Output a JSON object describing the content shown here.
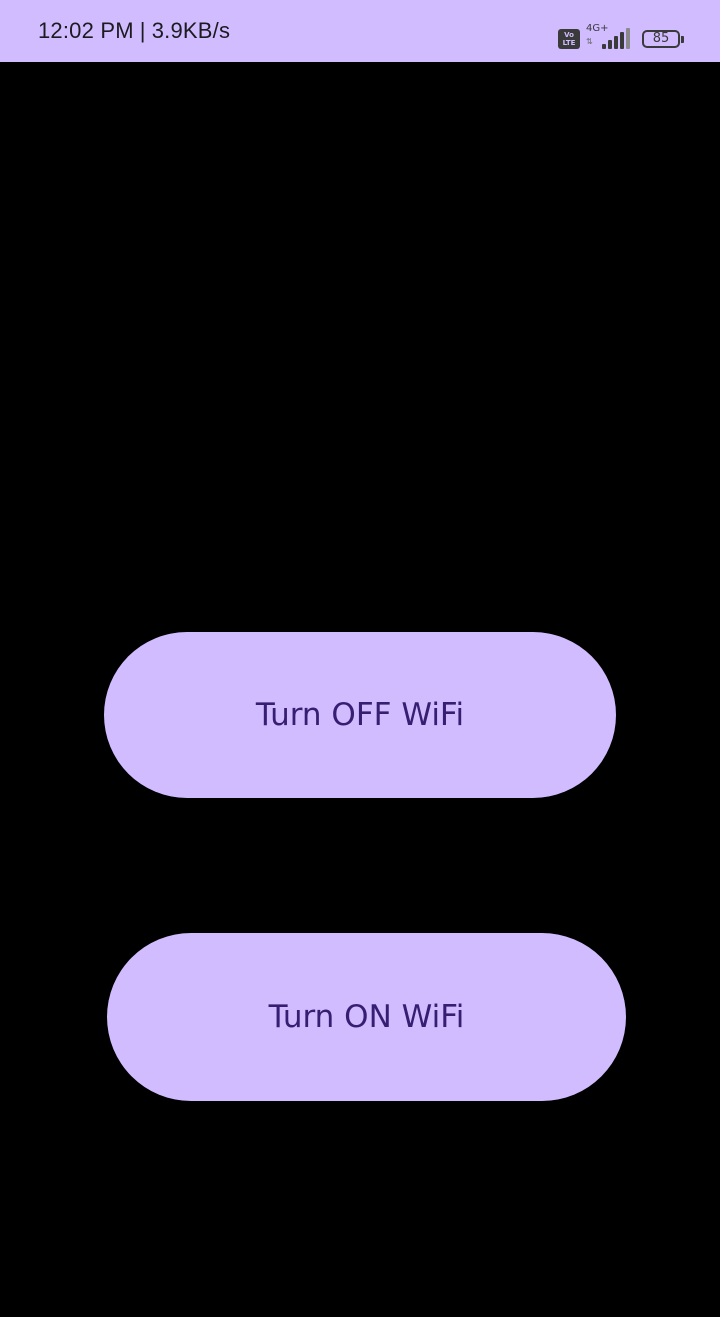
{
  "status_bar": {
    "time": "12:02 PM",
    "separator": "|",
    "net_speed": "3.9KB/s",
    "volte_top": "Vo",
    "volte_bottom": "LTE",
    "network_type": "4G+",
    "network_arrows": "⇅",
    "signal_level": 4,
    "battery_level": "85",
    "icons": [
      "volte-icon",
      "signal-icon",
      "battery-icon"
    ],
    "background": "#d0bcff"
  },
  "main": {
    "background": "#000000",
    "buttons": [
      {
        "label": "Turn OFF WiFi"
      },
      {
        "label": "Turn ON WiFi"
      }
    ],
    "button_color": "#d0bcff",
    "button_text_color": "#381e72"
  }
}
